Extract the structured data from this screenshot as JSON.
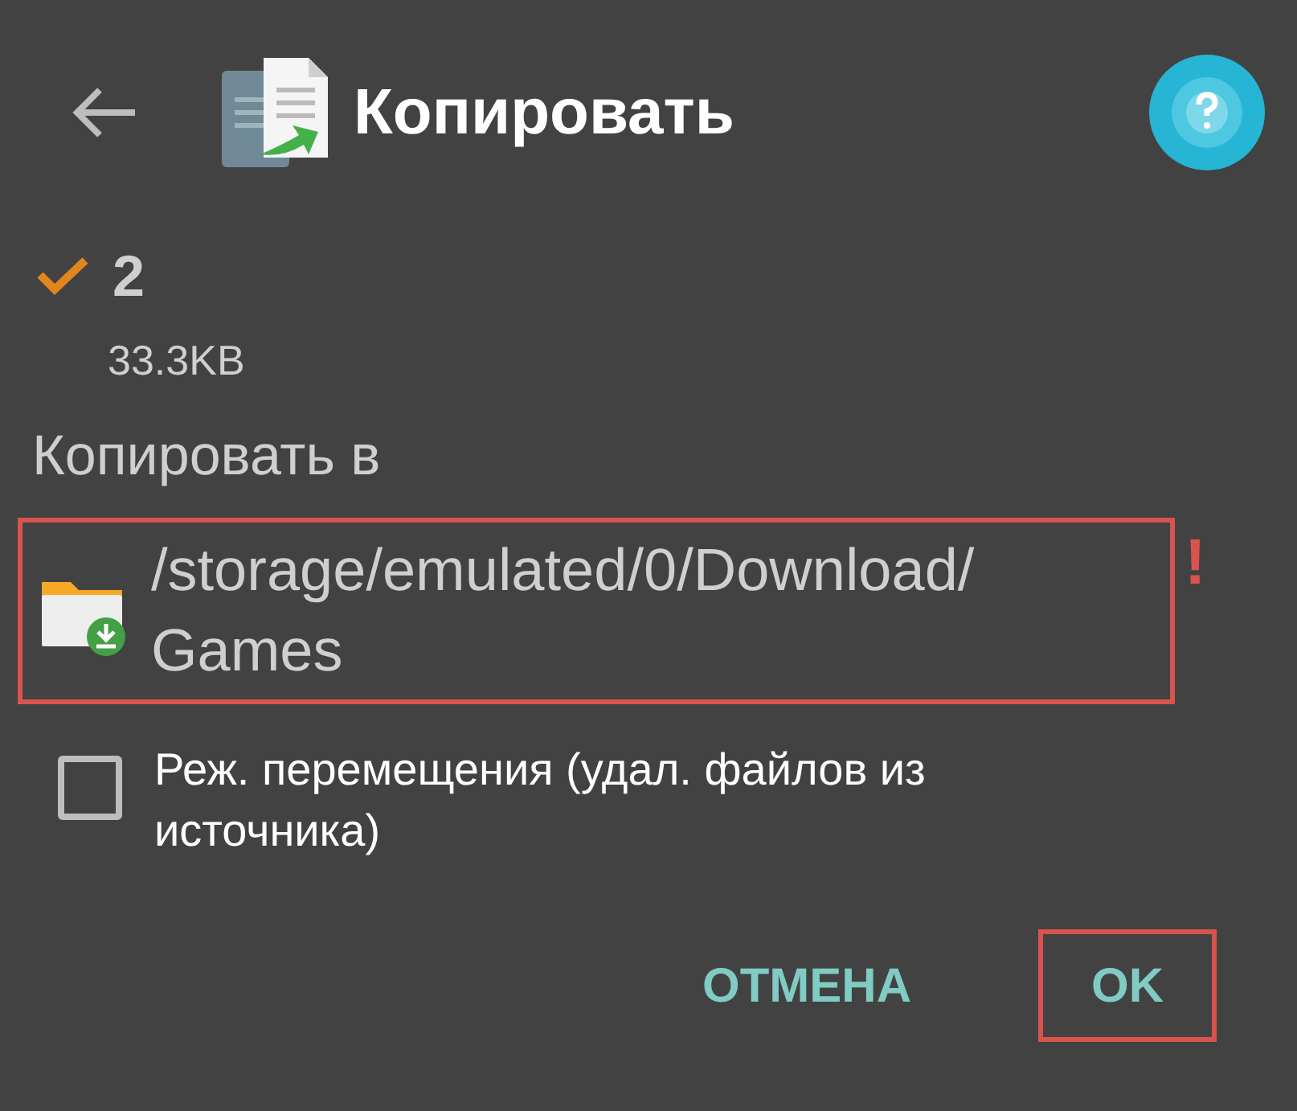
{
  "header": {
    "title": "Копировать"
  },
  "selection": {
    "count": "2",
    "size": "33.3KB"
  },
  "destination": {
    "label": "Копировать в",
    "path": "/storage/emulated/0/Download/Games",
    "highlighted": true,
    "warning": "!"
  },
  "move_mode": {
    "label": "Реж. перемещения (удал. файлов из источника)",
    "checked": false
  },
  "buttons": [
    {
      "label": "ОТМЕНА",
      "highlighted": false
    },
    {
      "label": "OK",
      "highlighted": true
    }
  ]
}
